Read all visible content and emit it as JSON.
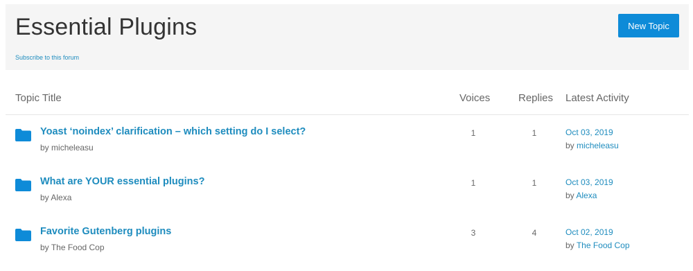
{
  "forum": {
    "title": "Essential Plugins",
    "subscribe_label": "Subscribe to this forum",
    "new_topic_label": "New Topic"
  },
  "table": {
    "headers": {
      "title": "Topic Title",
      "voices": "Voices",
      "replies": "Replies",
      "activity": "Latest Activity"
    },
    "topics": [
      {
        "title": "Yoast ‘noindex’ clarification – which setting do I select?",
        "author_prefix": "by",
        "author": "micheleasu",
        "voices": "1",
        "replies": "1",
        "activity_date": "Oct 03, 2019",
        "activity_by_prefix": "by",
        "activity_by": "micheleasu"
      },
      {
        "title": "What are YOUR essential plugins?",
        "author_prefix": "by",
        "author": "Alexa",
        "voices": "1",
        "replies": "1",
        "activity_date": "Oct 03, 2019",
        "activity_by_prefix": "by",
        "activity_by": "Alexa"
      },
      {
        "title": "Favorite Gutenberg plugins",
        "author_prefix": "by",
        "author": "The Food Cop",
        "voices": "3",
        "replies": "4",
        "activity_date": "Oct 02, 2019",
        "activity_by_prefix": "by",
        "activity_by": "The Food Cop"
      }
    ]
  },
  "colors": {
    "accent": "#1e8cbe",
    "button": "#0e8bd8",
    "header_bg": "#f5f5f5"
  },
  "icons": {
    "topic": "folder-icon"
  }
}
